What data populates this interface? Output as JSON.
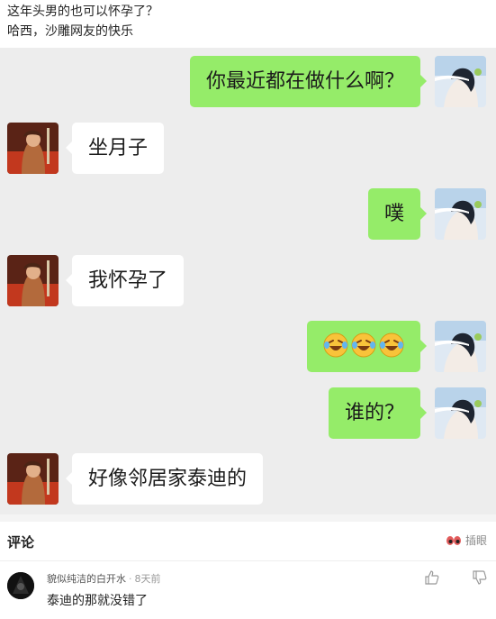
{
  "post": {
    "line1": "这年头男的也可以怀孕了？",
    "line2": "哈西，沙雕网友的快乐"
  },
  "messages": [
    {
      "side": "me",
      "text": "你最近都在做什么啊？"
    },
    {
      "side": "them",
      "text": "坐月子"
    },
    {
      "side": "me",
      "text": "噗"
    },
    {
      "side": "them",
      "text": "我怀孕了"
    },
    {
      "side": "me",
      "emoji": "😂😂😂"
    },
    {
      "side": "me",
      "text": "谁的？"
    },
    {
      "side": "them",
      "text": "好像邻居家泰迪的"
    }
  ],
  "comments_section": {
    "title": "评论",
    "insert_label": "插眼"
  },
  "comment": {
    "username": "貌似纯洁的白开水",
    "time": "8天前",
    "text": "泰迪的那就没错了"
  },
  "colors": {
    "chat_bg": "#ededed",
    "my_bubble": "#95ec69",
    "their_bubble": "#ffffff"
  }
}
